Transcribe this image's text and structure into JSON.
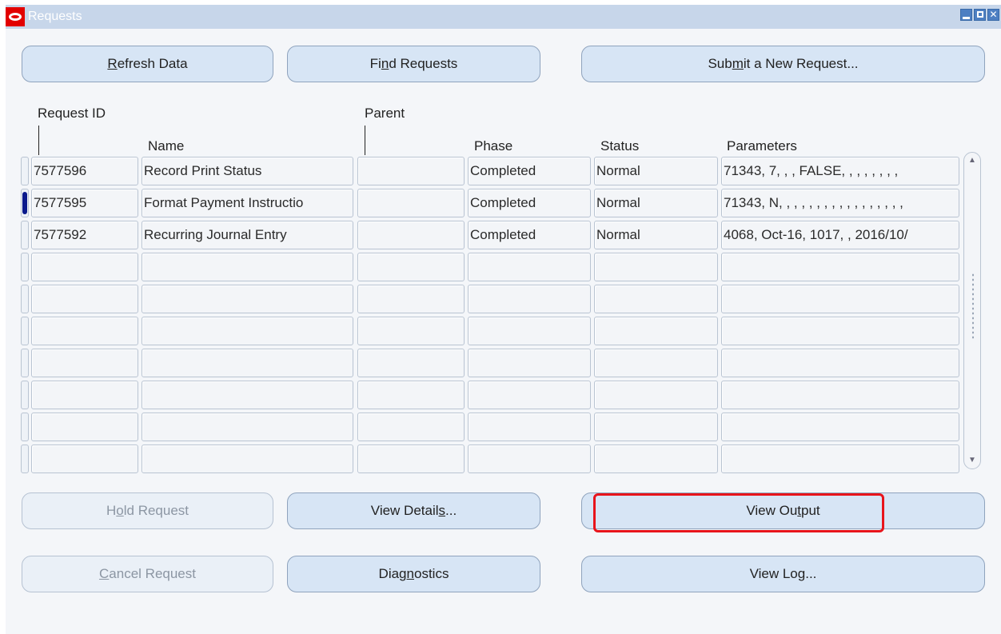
{
  "window": {
    "title": "Requests",
    "controls": {
      "minimize": "minimize-icon",
      "restore": "restore-icon",
      "close": "✕"
    }
  },
  "top_buttons": {
    "refresh": {
      "pre": "",
      "ul": "R",
      "post": "efresh Data"
    },
    "find": {
      "pre": "Fi",
      "ul": "n",
      "post": "d Requests"
    },
    "submit": {
      "pre": "Sub",
      "ul": "m",
      "post": "it a New Request..."
    }
  },
  "table": {
    "headers": {
      "request_id": "Request ID",
      "name": "Name",
      "parent": "Parent",
      "phase": "Phase",
      "status": "Status",
      "parameters": "Parameters"
    },
    "rows": [
      {
        "request_id": "7577596",
        "name": "Record Print Status",
        "parent": "",
        "phase": "Completed",
        "status": "Normal",
        "parameters": "71343, 7, , , FALSE, , , , , , , ,"
      },
      {
        "request_id": "7577595",
        "name": "Format Payment Instructio",
        "parent": "",
        "phase": "Completed",
        "status": "Normal",
        "parameters": "71343, N, , , , , , , , , , , , , , , , ,"
      },
      {
        "request_id": "7577592",
        "name": "Recurring Journal Entry",
        "parent": "",
        "phase": "Completed",
        "status": "Normal",
        "parameters": "4068, Oct-16, 1017, , 2016/10/"
      }
    ],
    "active_row": 1,
    "empty_rows": 7
  },
  "bottom_buttons": {
    "hold": {
      "pre": "H",
      "ul": "o",
      "post": "ld Request"
    },
    "view_details": {
      "pre": "View Detail",
      "ul": "s",
      "post": "..."
    },
    "view_output": {
      "pre": "View Ou",
      "ul": "t",
      "post": "put"
    },
    "cancel": {
      "pre": "",
      "ul": "C",
      "post": "ancel Request"
    },
    "diagnostics": {
      "pre": "Diag",
      "ul": "n",
      "post": "ostics"
    },
    "view_log": {
      "pre": "View Lo",
      "ul": "g",
      "post": "..."
    }
  }
}
